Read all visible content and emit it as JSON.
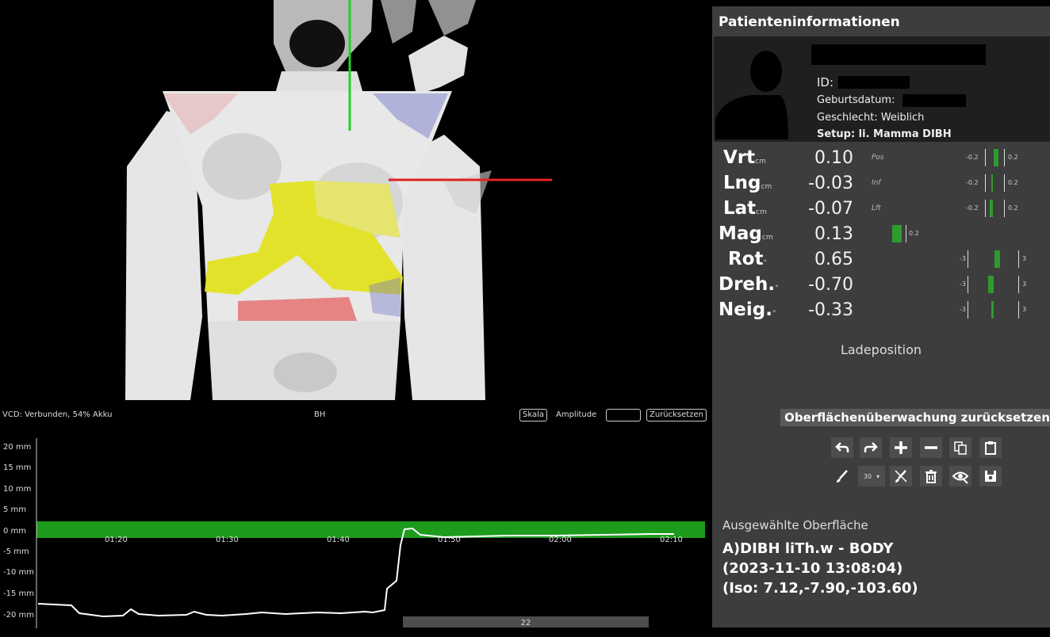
{
  "viewport": {
    "colors": {
      "surface": "#e6e6e6",
      "overlay": "#e3e22b",
      "hot": "#e43232",
      "cold": "#6f72c9",
      "axis_y": "#22d12b",
      "axis_x": "#e22020"
    }
  },
  "scan_bar": {
    "status": "VCD: Verbunden, 54% Akku",
    "mode": "BH",
    "scale_button": "Skala",
    "amplitude_label": "Amplitude",
    "amplitude_value": "",
    "reset_button": "Zurücksetzen"
  },
  "breathing": {
    "y_ticks": [
      "20 mm",
      "15 mm",
      "10 mm",
      "5 mm",
      "0 mm",
      "-5 mm",
      "-10 mm",
      "-15 mm",
      "-20 mm"
    ],
    "x_ticks": [
      "01:20",
      "01:30",
      "01:40",
      "01:50",
      "02:00",
      "02:10"
    ],
    "scroll_label": "22",
    "window_color": "#1d9b1d"
  },
  "patient": {
    "title": "Patienteninformationen",
    "id_label": "ID:",
    "birth_label": "Geburtsdatum:",
    "gender": "Geschlecht: Weiblich",
    "setup": "Setup: li. Mamma DIBH"
  },
  "metrics": [
    {
      "name": "Vrt",
      "unit": "cm",
      "value": "0.10",
      "dir": "Pos",
      "neg": "-0.2",
      "pos": "0.2"
    },
    {
      "name": "Lng",
      "unit": "cm",
      "value": "-0.03",
      "dir": "Inf",
      "neg": "-0.2",
      "pos": "0.2"
    },
    {
      "name": "Lat",
      "unit": "cm",
      "value": "-0.07",
      "dir": "Lft",
      "neg": "-0.2",
      "pos": "0.2"
    },
    {
      "name": "Mag",
      "unit": "cm",
      "value": "0.13",
      "dir": "",
      "neg": "",
      "pos": "0.2"
    },
    {
      "name": "Rot",
      "unit": "°",
      "value": "0.65",
      "dir": "",
      "neg": "-3",
      "pos": "3"
    },
    {
      "name": "Dreh.",
      "unit": "°",
      "value": "-0.70",
      "dir": "",
      "neg": "-3",
      "pos": "3"
    },
    {
      "name": "Neig.",
      "unit": "°",
      "value": "-0.33",
      "dir": "",
      "neg": "-3",
      "pos": "3"
    }
  ],
  "load_position": "Ladeposition",
  "surface_reset_button": "Oberflächenüberwachung zurücksetzen",
  "toolbar": {
    "icons": [
      "undo-icon",
      "redo-icon",
      "plus-icon",
      "minus-icon",
      "copy-icon",
      "clipboard-icon",
      "brush-icon",
      "brush-size-select",
      "erase-brush-icon",
      "trash-icon",
      "eye-icon",
      "save-icon"
    ],
    "brush_size": "30"
  },
  "selected_surface": {
    "label": "Ausgewählte Oberfläche",
    "line1": "A)DIBH liTh.w - BODY",
    "line2": "(2023-11-10 13:08:04)",
    "line3": "(Iso: 7.12,-7.90,-103.60)"
  }
}
